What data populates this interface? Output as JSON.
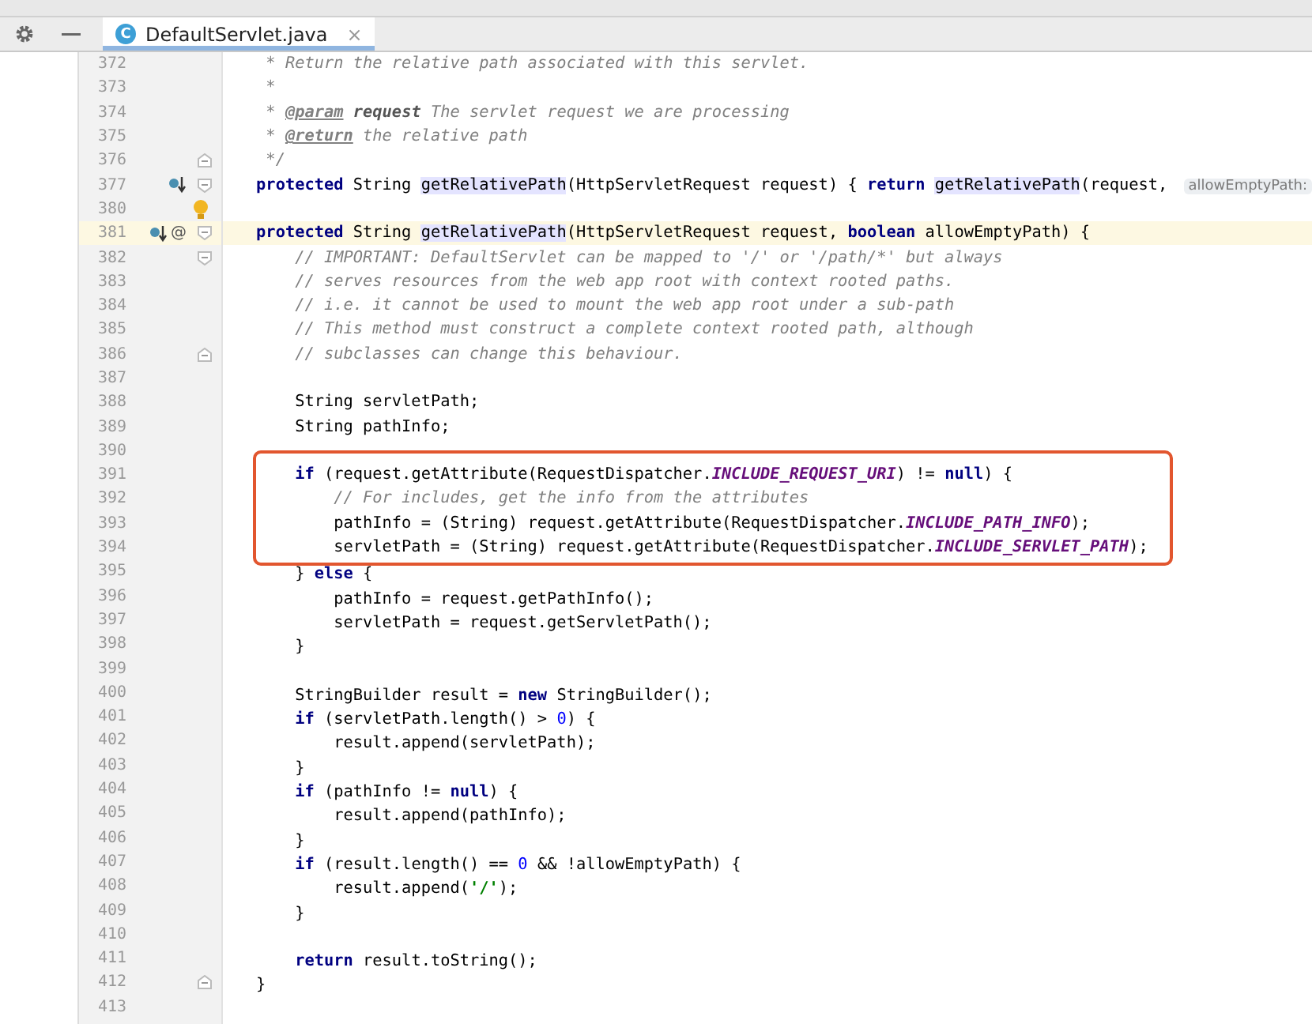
{
  "tab_bar": {
    "tab": {
      "icon_letter": "C",
      "label": "DefaultServlet.java",
      "close": "×",
      "selected": true
    }
  },
  "editor": {
    "blocks": [
      {
        "kind": "plain",
        "lines": [
          {
            "no": "372",
            "segs": [
              {
                "text": " * Return the relative path associated with this servlet.",
                "kind": "comment"
              }
            ]
          },
          {
            "no": "373",
            "segs": [
              {
                "text": " *",
                "kind": "comment"
              }
            ]
          },
          {
            "no": "374",
            "segs": [
              {
                "text": " * ",
                "kind": "comment"
              },
              {
                "text": "@param",
                "kind": "doctag"
              },
              {
                "text": " request",
                "kind": "docbold"
              },
              {
                "text": " The servlet request we are processing",
                "kind": "comment"
              }
            ]
          },
          {
            "no": "375",
            "segs": [
              {
                "text": " * ",
                "kind": "comment"
              },
              {
                "text": "@return",
                "kind": "doctag"
              },
              {
                "text": " the relative path",
                "kind": "comment"
              }
            ]
          },
          {
            "no": "376",
            "segs": [
              {
                "text": " */",
                "kind": "comment"
              }
            ],
            "fold_end": true
          },
          {
            "no": "377",
            "segs": [
              {
                "text": "protected",
                "kind": "keyword"
              },
              {
                "text": " String ",
                "kind": "plain"
              },
              {
                "text": "getRelativePath",
                "kind": "usage"
              },
              {
                "text": "(HttpServletRequest request) { ",
                "kind": "plain"
              },
              {
                "text": "return ",
                "kind": "keyword"
              },
              {
                "text": "getRelativePath",
                "kind": "usage"
              },
              {
                "text": "(request, ",
                "kind": "plain"
              },
              {
                "text": "allowEmptyPath:",
                "kind": "hint"
              }
            ],
            "override_marker": true,
            "fold_start": true
          },
          {
            "no": "380",
            "bulb": true
          }
        ]
      },
      {
        "kind": "current",
        "lines": [
          {
            "no": "381",
            "segs": [
              {
                "text": "protected",
                "kind": "keyword"
              },
              {
                "text": " String ",
                "kind": "plain"
              },
              {
                "text": "getRelativePath",
                "kind": "usage"
              },
              {
                "text": "(HttpServletRequest request, ",
                "kind": "plain"
              },
              {
                "text": "boolean",
                "kind": "keyword"
              },
              {
                "text": " allowEmptyPath) {",
                "kind": "plain"
              }
            ],
            "override_marker": true,
            "gutter_text": "@",
            "fold_start": true
          }
        ]
      },
      {
        "kind": "plain",
        "lines": [
          {
            "no": "382",
            "segs": [
              {
                "text": "    // IMPORTANT: DefaultServlet can be mapped to '/' or '/path/*' but always",
                "kind": "comment"
              }
            ],
            "fold_start": true
          },
          {
            "no": "383",
            "segs": [
              {
                "text": "    // serves resources from the web app root with context rooted paths.",
                "kind": "comment"
              }
            ]
          },
          {
            "no": "384",
            "segs": [
              {
                "text": "    // i.e. it cannot be used to mount the web app root under a sub-path",
                "kind": "comment"
              }
            ]
          },
          {
            "no": "385",
            "segs": [
              {
                "text": "    // This method must construct a complete context rooted path, although",
                "kind": "comment"
              }
            ]
          },
          {
            "no": "386",
            "segs": [
              {
                "text": "    // subclasses can change this behaviour.",
                "kind": "comment"
              }
            ],
            "fold_end": true
          },
          {
            "no": "387"
          },
          {
            "no": "388",
            "segs": [
              {
                "text": "    String servletPath;",
                "kind": "plain"
              }
            ]
          },
          {
            "no": "389",
            "segs": [
              {
                "text": "    String pathInfo;",
                "kind": "plain"
              }
            ]
          },
          {
            "no": "390"
          }
        ]
      },
      {
        "kind": "boxed",
        "lines": [
          {
            "no": "391",
            "segs": [
              {
                "text": "    if",
                "kind": "keyword"
              },
              {
                "text": " (request.getAttribute(RequestDispatcher.",
                "kind": "plain"
              },
              {
                "text": "INCLUDE_REQUEST_URI",
                "kind": "constant"
              },
              {
                "text": ") != ",
                "kind": "plain"
              },
              {
                "text": "null",
                "kind": "keyword"
              },
              {
                "text": ") {",
                "kind": "plain"
              }
            ]
          },
          {
            "no": "392",
            "segs": [
              {
                "text": "        // For includes, get the info from the attributes",
                "kind": "comment"
              }
            ]
          },
          {
            "no": "393",
            "segs": [
              {
                "text": "        pathInfo = (String) request.getAttribute(RequestDispatcher.",
                "kind": "plain"
              },
              {
                "text": "INCLUDE_PATH_INFO",
                "kind": "constant"
              },
              {
                "text": ");",
                "kind": "plain"
              }
            ]
          },
          {
            "no": "394",
            "segs": [
              {
                "text": "        servletPath = (String) request.getAttribute(RequestDispatcher.",
                "kind": "plain"
              },
              {
                "text": "INCLUDE_SERVLET_PATH",
                "kind": "constant"
              },
              {
                "text": ");",
                "kind": "plain"
              }
            ]
          }
        ]
      },
      {
        "kind": "plain",
        "lines": [
          {
            "no": "395",
            "segs": [
              {
                "text": "    } ",
                "kind": "plain"
              },
              {
                "text": "else",
                "kind": "keyword"
              },
              {
                "text": " {",
                "kind": "plain"
              }
            ]
          },
          {
            "no": "396",
            "segs": [
              {
                "text": "        pathInfo = request.getPathInfo();",
                "kind": "plain"
              }
            ]
          },
          {
            "no": "397",
            "segs": [
              {
                "text": "        servletPath = request.getServletPath();",
                "kind": "plain"
              }
            ]
          },
          {
            "no": "398",
            "segs": [
              {
                "text": "    }",
                "kind": "plain"
              }
            ]
          },
          {
            "no": "399"
          },
          {
            "no": "400",
            "segs": [
              {
                "text": "    StringBuilder result = ",
                "kind": "plain"
              },
              {
                "text": "new",
                "kind": "keyword"
              },
              {
                "text": " StringBuilder();",
                "kind": "plain"
              }
            ]
          },
          {
            "no": "401",
            "segs": [
              {
                "text": "    if",
                "kind": "keyword"
              },
              {
                "text": " (servletPath.length() > ",
                "kind": "plain"
              },
              {
                "text": "0",
                "kind": "number"
              },
              {
                "text": ") {",
                "kind": "plain"
              }
            ]
          },
          {
            "no": "402",
            "segs": [
              {
                "text": "        result.append(servletPath);",
                "kind": "plain"
              }
            ]
          },
          {
            "no": "403",
            "segs": [
              {
                "text": "    }",
                "kind": "plain"
              }
            ]
          },
          {
            "no": "404",
            "segs": [
              {
                "text": "    if",
                "kind": "keyword"
              },
              {
                "text": " (pathInfo != ",
                "kind": "plain"
              },
              {
                "text": "null",
                "kind": "keyword"
              },
              {
                "text": ") {",
                "kind": "plain"
              }
            ]
          },
          {
            "no": "405",
            "segs": [
              {
                "text": "        result.append(pathInfo);",
                "kind": "plain"
              }
            ]
          },
          {
            "no": "406",
            "segs": [
              {
                "text": "    }",
                "kind": "plain"
              }
            ]
          },
          {
            "no": "407",
            "segs": [
              {
                "text": "    if",
                "kind": "keyword"
              },
              {
                "text": " (result.length() == ",
                "kind": "plain"
              },
              {
                "text": "0",
                "kind": "number"
              },
              {
                "text": " && !allowEmptyPath) {",
                "kind": "plain"
              }
            ]
          },
          {
            "no": "408",
            "segs": [
              {
                "text": "        result.append(",
                "kind": "plain"
              },
              {
                "text": "'/'",
                "kind": "string"
              },
              {
                "text": ");",
                "kind": "plain"
              }
            ]
          },
          {
            "no": "409",
            "segs": [
              {
                "text": "    }",
                "kind": "plain"
              }
            ]
          },
          {
            "no": "410"
          },
          {
            "no": "411",
            "segs": [
              {
                "text": "    return",
                "kind": "keyword"
              },
              {
                "text": " result.toString();",
                "kind": "plain"
              }
            ]
          },
          {
            "no": "412",
            "segs": [
              {
                "text": "}",
                "kind": "plain"
              }
            ],
            "fold_end": true
          },
          {
            "no": "413"
          }
        ]
      }
    ]
  }
}
